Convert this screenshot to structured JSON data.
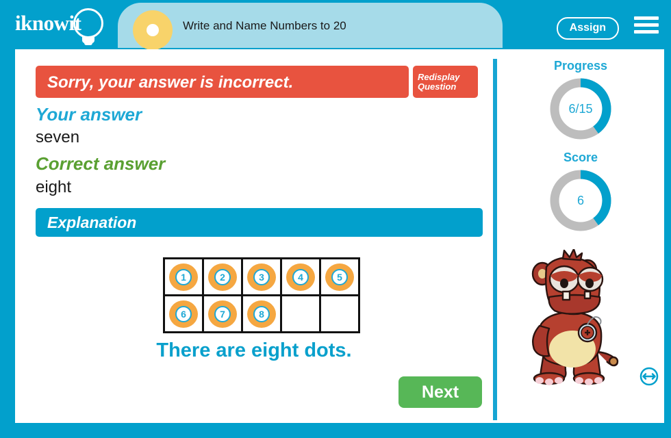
{
  "brand": {
    "logo_text": "iknowit",
    "logo_icon": "lightbulb-icon",
    "primary_blue": "#02A0CC",
    "light_blue": "#A6DBE9",
    "accent_yellow": "#F8D36A",
    "error_red": "#E8533F",
    "correct_green": "#5AA032",
    "next_green": "#57B757",
    "dot_orange": "#F5A741"
  },
  "header": {
    "lesson_title": "Write and Name Numbers to 20",
    "assign_label": "Assign",
    "menu_icon": "hamburger-menu-icon",
    "bullet_icon": "circle-dot-icon"
  },
  "feedback": {
    "banner_text": "Sorry, your answer is incorrect.",
    "redisplay_line1": "Redisplay",
    "redisplay_line2": "Question",
    "your_answer_label": "Your answer",
    "your_answer_value": "seven",
    "correct_answer_label": "Correct answer",
    "correct_answer_value": "eight",
    "explanation_label": "Explanation",
    "explanation_sentence": "There are eight dots.",
    "next_label": "Next"
  },
  "tenframe": {
    "rows": 2,
    "cols": 5,
    "filled_count": 8,
    "cells": [
      [
        "1",
        "2",
        "3",
        "4",
        "5"
      ],
      [
        "6",
        "7",
        "8",
        "",
        ""
      ]
    ]
  },
  "sidebar": {
    "progress": {
      "title": "Progress",
      "value": "6/15",
      "percent": 40
    },
    "score": {
      "title": "Score",
      "value": "6",
      "percent": 40
    },
    "mascot_icon": "monster-mascot-character",
    "resize_icon": "horizontal-resize-arrows-icon"
  }
}
